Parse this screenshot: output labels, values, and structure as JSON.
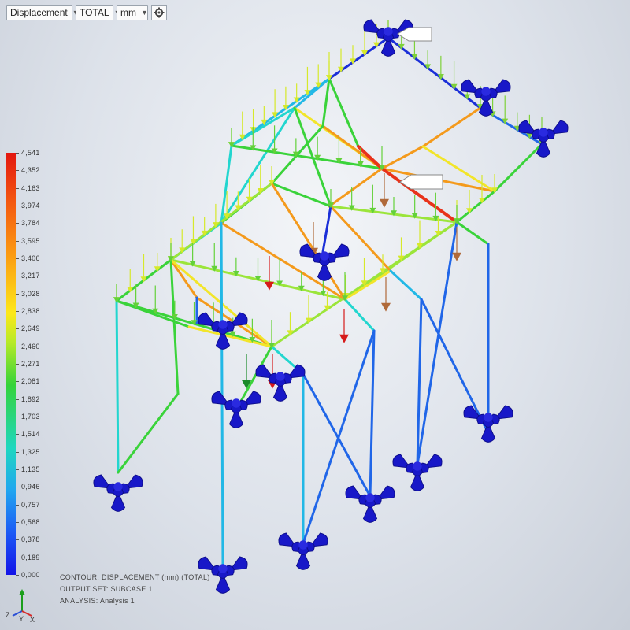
{
  "toolbar": {
    "result_type": "Displacement",
    "component": "TOTAL",
    "unit": "mm",
    "settings_icon": "gear-icon"
  },
  "legend": {
    "ticks": [
      "4,541",
      "4,352",
      "4,163",
      "3,974",
      "3,784",
      "3,595",
      "3,406",
      "3,217",
      "3,028",
      "2,838",
      "2,649",
      "2,460",
      "2,271",
      "2,081",
      "1,892",
      "1,703",
      "1,514",
      "1,325",
      "1,135",
      "0,946",
      "0,757",
      "0,568",
      "0,378",
      "0,189",
      "0,000"
    ],
    "max_color": "#e3160f",
    "min_color": "#1313e8"
  },
  "info": {
    "contour": "CONTOUR: DISPLACEMENT (mm) (TOTAL)",
    "output_set": "OUTPUT SET: SUBCASE 1",
    "analysis": "ANALYSIS: Analysis 1"
  },
  "triad": {
    "z": "Z",
    "x": "X",
    "y": "Y"
  },
  "markers": {
    "max_marker": "max-label-flag",
    "top_marker": "top-label-flag"
  }
}
